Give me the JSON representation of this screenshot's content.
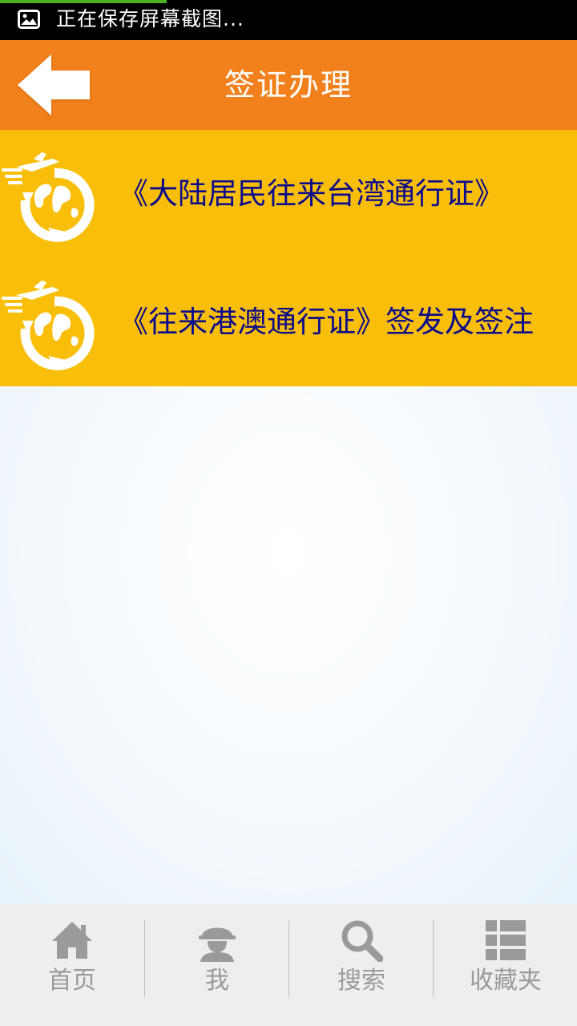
{
  "status_bar": {
    "notification_icon": "image-icon",
    "text": "正在保存屏幕截图..."
  },
  "header": {
    "back_icon": "back-arrow-icon",
    "title": "签证办理",
    "color": "#f2801c"
  },
  "list": {
    "background": "#f9be0a",
    "items": [
      {
        "icon": "globe-plane-icon",
        "label": "《大陆居民往来台湾通行证》"
      },
      {
        "icon": "globe-plane-icon",
        "label": "《往来港澳通行证》签发及签注"
      }
    ]
  },
  "bottom_nav": {
    "items": [
      {
        "icon": "home-icon",
        "label": "首页"
      },
      {
        "icon": "user-icon",
        "label": "我"
      },
      {
        "icon": "search-icon",
        "label": "搜索"
      },
      {
        "icon": "list-icon",
        "label": "收藏夹"
      }
    ]
  }
}
